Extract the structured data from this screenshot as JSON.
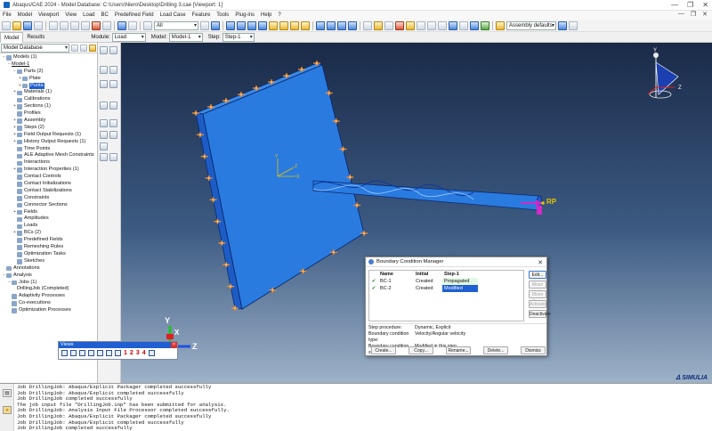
{
  "window": {
    "title": "Abaqus/CAE 2024 - Model Database: C:\\Users\\Niero\\Desktop\\Drilling 3.cae [Viewport: 1]",
    "controls": [
      "—",
      "❐",
      "✕"
    ]
  },
  "menu": {
    "items": [
      "File",
      "Model",
      "Viewport",
      "View",
      "Load",
      "BC",
      "Predefined Field",
      "Load Case",
      "Feature",
      "Tools",
      "Plug-ins",
      "Help",
      "?"
    ],
    "right_controls": [
      "—",
      "❐",
      "✕"
    ]
  },
  "toolbar": {
    "selection_filter": "All",
    "assembly_display": "Assembly defaults"
  },
  "context": {
    "tabs": [
      "Model",
      "Results"
    ],
    "module_label": "Module:",
    "module_value": "Load",
    "model_label": "Model:",
    "model_value": "Model-1",
    "step_label": "Step:",
    "step_value": "Step-1"
  },
  "tree": {
    "database": "Model Database",
    "items": [
      {
        "label": "Models (1)",
        "depth": 0,
        "toggle": "−",
        "icon": "models-icon"
      },
      {
        "label": "Model-1",
        "depth": 1,
        "toggle": "−",
        "icon": "",
        "underline": true
      },
      {
        "label": "Parts (2)",
        "depth": 2,
        "toggle": "−",
        "icon": "parts-icon"
      },
      {
        "label": "Plate",
        "depth": 3,
        "toggle": "+",
        "icon": "part-icon"
      },
      {
        "label": "Punta",
        "depth": 3,
        "toggle": "+",
        "icon": "part-icon",
        "selected": true
      },
      {
        "label": "Materials (1)",
        "depth": 2,
        "toggle": "+",
        "icon": "materials-icon"
      },
      {
        "label": "Calibrations",
        "depth": 2,
        "toggle": "",
        "icon": "calibrations-icon"
      },
      {
        "label": "Sections (1)",
        "depth": 2,
        "toggle": "+",
        "icon": "sections-icon"
      },
      {
        "label": "Profiles",
        "depth": 2,
        "toggle": "",
        "icon": "profiles-icon"
      },
      {
        "label": "Assembly",
        "depth": 2,
        "toggle": "+",
        "icon": "assembly-icon"
      },
      {
        "label": "Steps (2)",
        "depth": 2,
        "toggle": "+",
        "icon": "steps-icon"
      },
      {
        "label": "Field Output Requests (1)",
        "depth": 2,
        "toggle": "+",
        "icon": "field-output-icon"
      },
      {
        "label": "History Output Requests (1)",
        "depth": 2,
        "toggle": "+",
        "icon": "history-output-icon"
      },
      {
        "label": "Time Points",
        "depth": 2,
        "toggle": "",
        "icon": "time-points-icon"
      },
      {
        "label": "ALE Adaptive Mesh Constraints",
        "depth": 2,
        "toggle": "",
        "icon": "ale-icon"
      },
      {
        "label": "Interactions",
        "depth": 2,
        "toggle": "",
        "icon": "interactions-icon"
      },
      {
        "label": "Interaction Properties (1)",
        "depth": 2,
        "toggle": "+",
        "icon": "interaction-props-icon"
      },
      {
        "label": "Contact Controls",
        "depth": 2,
        "toggle": "",
        "icon": "contact-controls-icon"
      },
      {
        "label": "Contact Initializations",
        "depth": 2,
        "toggle": "",
        "icon": "contact-init-icon"
      },
      {
        "label": "Contact Stabilizations",
        "depth": 2,
        "toggle": "",
        "icon": "contact-stab-icon"
      },
      {
        "label": "Constraints",
        "depth": 2,
        "toggle": "",
        "icon": "constraints-icon"
      },
      {
        "label": "Connector Sections",
        "depth": 2,
        "toggle": "",
        "icon": "connector-icon"
      },
      {
        "label": "Fields",
        "depth": 2,
        "toggle": "+",
        "icon": "fields-icon"
      },
      {
        "label": "Amplitudes",
        "depth": 2,
        "toggle": "",
        "icon": "amplitudes-icon"
      },
      {
        "label": "Loads",
        "depth": 2,
        "toggle": "",
        "icon": "loads-icon"
      },
      {
        "label": "BCs (2)",
        "depth": 2,
        "toggle": "+",
        "icon": "bcs-icon"
      },
      {
        "label": "Predefined Fields",
        "depth": 2,
        "toggle": "",
        "icon": "predefined-icon"
      },
      {
        "label": "Remeshing Rules",
        "depth": 2,
        "toggle": "",
        "icon": "remeshing-icon"
      },
      {
        "label": "Optimization Tasks",
        "depth": 2,
        "toggle": "",
        "icon": "optimization-icon"
      },
      {
        "label": "Sketches",
        "depth": 2,
        "toggle": "",
        "icon": "sketches-icon"
      },
      {
        "label": "Annotations",
        "depth": 0,
        "toggle": "",
        "icon": "annotations-icon"
      },
      {
        "label": "Analysis",
        "depth": 0,
        "toggle": "−",
        "icon": "analysis-icon"
      },
      {
        "label": "Jobs (1)",
        "depth": 1,
        "toggle": "−",
        "icon": "jobs-icon"
      },
      {
        "label": "DrillingJob (Completed)",
        "depth": 2,
        "toggle": "",
        "icon": ""
      },
      {
        "label": "Adaptivity Processes",
        "depth": 1,
        "toggle": "",
        "icon": "adaptivity-icon"
      },
      {
        "label": "Co-executions",
        "depth": 1,
        "toggle": "",
        "icon": "coexec-icon"
      },
      {
        "label": "Optimization Processes",
        "depth": 1,
        "toggle": "",
        "icon": "opt-process-icon"
      }
    ]
  },
  "viewport": {
    "csys_labels": {
      "y": "Y",
      "z": "Z",
      "x": "X"
    },
    "triad": {
      "y": "Y",
      "z": "Z",
      "x": "X"
    },
    "rp_label": "RP",
    "brand": "SIMULIA",
    "colors": {
      "part": "#2a7be0",
      "bc_marker": "#e88a2a",
      "rp": "#e6c400"
    }
  },
  "views_toolbar": {
    "title": "Views",
    "numbers": [
      "1",
      "2",
      "3",
      "4"
    ]
  },
  "bc_manager": {
    "title": "Boundary Condition Manager",
    "columns": [
      "Name",
      "Initial",
      "Step-1"
    ],
    "rows": [
      {
        "check": "✔",
        "name": "BC-1",
        "initial": "Created",
        "step1": "Propagated"
      },
      {
        "check": "✔",
        "name": "BC-2",
        "initial": "Created",
        "step1": "Modified"
      }
    ],
    "side_buttons": [
      "Edit...",
      "Move Left",
      "Move Right",
      "Activate",
      "Deactivate"
    ],
    "info": [
      {
        "k": "Step procedure:",
        "v": "Dynamic, Explicit"
      },
      {
        "k": "Boundary condition type:",
        "v": "Velocity/Angular velocity"
      },
      {
        "k": "Boundary condition status:",
        "v": "Modified in this step"
      }
    ],
    "bottom_buttons": [
      "Create...",
      "Copy...",
      "Rename...",
      "Delete...",
      "Dismiss"
    ]
  },
  "messages": [
    "Job DrillingJob: Abaqus/Explicit Packager completed successfully",
    "Job DrillingJob: Abaqus/Explicit completed successfully",
    "Job DrillingJob completed successfully",
    "The job input file \"DrillingJob.inp\" has been submitted for analysis.",
    "Job DrillingJob: Analysis Input File Processor completed successfully.",
    "Job DrillingJob: Abaqus/Explicit Packager completed successfully",
    "Job DrillingJob: Abaqus/Explicit completed successfully",
    "Job DrillingJob completed successfully"
  ]
}
